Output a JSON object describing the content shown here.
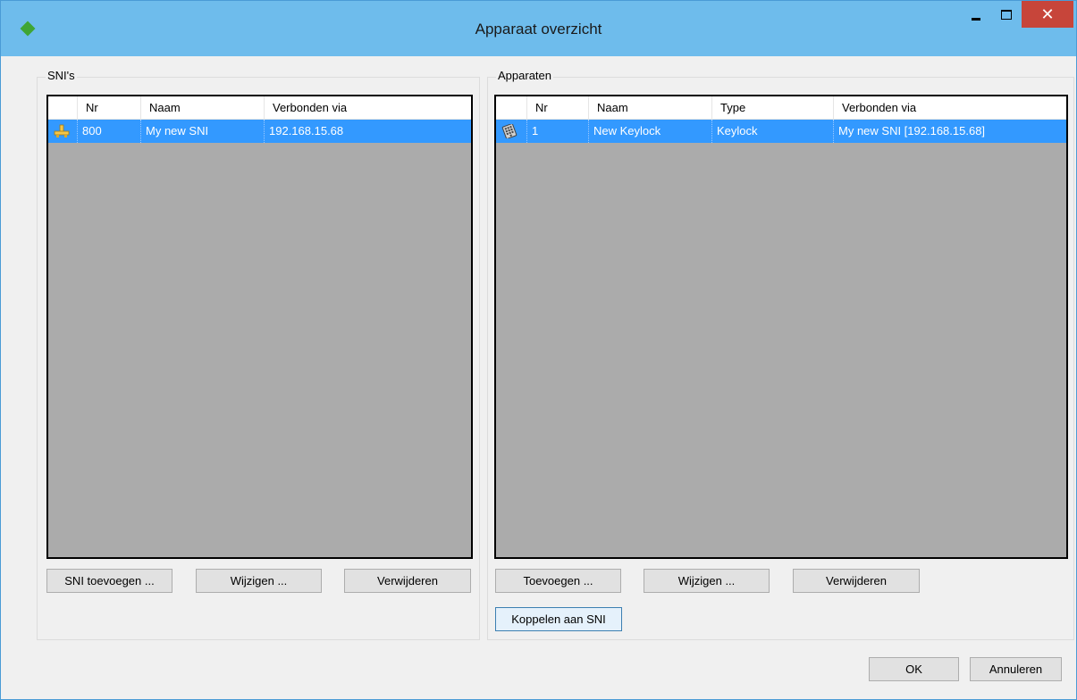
{
  "window": {
    "title": "Apparaat overzicht",
    "close_glyph": "✕"
  },
  "sni_group": {
    "label": "SNI's",
    "columns": [
      "Nr",
      "Naam",
      "Verbonden via"
    ],
    "rows": [
      {
        "icon": "network-connector-icon",
        "nr": "800",
        "naam": "My new SNI",
        "verbonden_via": "192.168.15.68",
        "selected": true
      }
    ],
    "buttons": {
      "add": "SNI toevoegen ...",
      "edit": "Wijzigen ...",
      "delete": "Verwijderen"
    }
  },
  "devices_group": {
    "label": "Apparaten",
    "columns": [
      "Nr",
      "Naam",
      "Type",
      "Verbonden via"
    ],
    "rows": [
      {
        "icon": "keylock-icon",
        "nr": "1",
        "naam": "New Keylock",
        "type": "Keylock",
        "verbonden_via": "My new SNI [192.168.15.68]",
        "selected": true
      }
    ],
    "buttons": {
      "add": "Toevoegen ...",
      "edit": "Wijzigen ...",
      "delete": "Verwijderen",
      "link": "Koppelen aan SNI"
    }
  },
  "dialog_buttons": {
    "ok": "OK",
    "cancel": "Annuleren"
  },
  "colors": {
    "titlebar": "#6ebcec",
    "selection": "#3399ff",
    "list_background": "#ababab",
    "close_button": "#c7453a"
  }
}
